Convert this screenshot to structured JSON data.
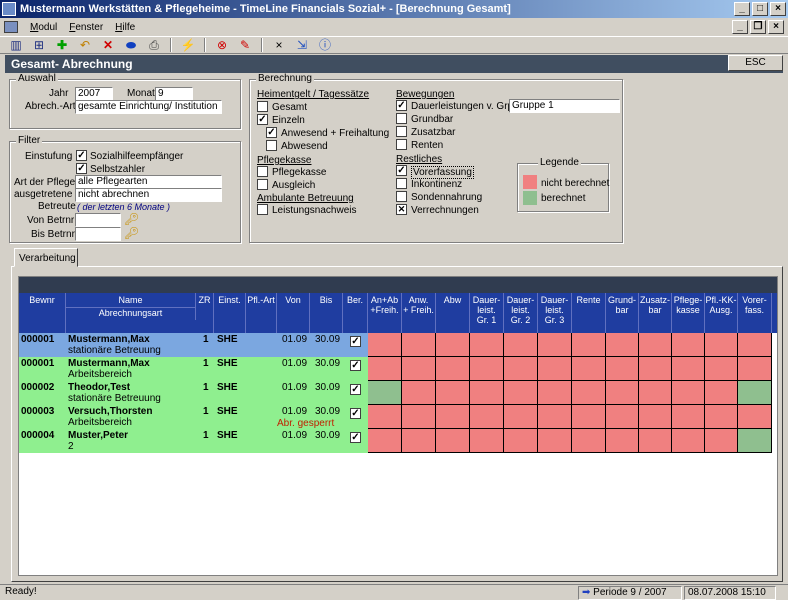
{
  "window": {
    "title": "Mustermann Werkstätten & Pflegeheime - TimeLine Financials Sozial+ - [Berechnung Gesamt]"
  },
  "menu": {
    "items": [
      {
        "label": "Modul",
        "ul": "M",
        "rest": "odul"
      },
      {
        "label": "Fenster",
        "ul": "F",
        "rest": "enster"
      },
      {
        "label": "Hilfe",
        "ul": "H",
        "rest": "ilfe"
      }
    ]
  },
  "toolbar": {
    "icons": [
      "view-icon",
      "tree-icon",
      "add-icon",
      "undo-icon",
      "delete-icon",
      "save-icon",
      "print-icon",
      "lightning-icon",
      "stop-icon",
      "edit-icon",
      "close-icon",
      "export-icon",
      "help-icon"
    ]
  },
  "header": {
    "title": "Gesamt- Abrechnung",
    "esc_label": "ESC"
  },
  "auswahl": {
    "title": "Auswahl",
    "jahr_label": "Jahr",
    "jahr": "2007",
    "monat_label": "Monat",
    "monat": "9",
    "abrech_label": "Abrech.-Art",
    "abrech": "gesamte Einrichtung/ Institution"
  },
  "filter": {
    "title": "Filter",
    "einstufung_label": "Einstufung",
    "sozialhilfe": "Sozialhilfeempfänger",
    "selbstzahler": "Selbstzahler",
    "pflege_label": "Art der Pflege",
    "pflege": "alle Pflegearten",
    "ausgetretene_label": "ausgetretene",
    "ausgetretene": "nicht abrechnen",
    "betreute_label": "Betreute",
    "betreute": "( der letzten 6 Monate )",
    "von_label": "Von Betrnr",
    "bis_label": "Bis Betrnr"
  },
  "berechnung": {
    "title": "Berechnung",
    "heim_title": "Heimentgelt / Tagessätze",
    "gesamt": "Gesamt",
    "einzeln": "Einzeln",
    "anwesend_frei": "Anwesend + Freihaltung",
    "abwesend": "Abwesend",
    "pflege_title": "Pflegekasse",
    "pflegekasse": "Pflegekasse",
    "ausgleich": "Ausgleich",
    "amb_title": "Ambulante Betreuung",
    "leistung": "Leistungsnachweis",
    "bew_title": "Bewegungen",
    "dauer": "Dauerleistungen v. Grp.",
    "gruppe": "Gruppe 1",
    "grundbar": "Grundbar",
    "zusatzbar": "Zusatzbar",
    "renten": "Renten",
    "rest_title": "Restliches",
    "vorerfassung": "Vorerfassung",
    "inkontinenz": "Inkontinenz",
    "sondennahrung": "Sondennahrung",
    "verrechnungen": "Verrechnungen"
  },
  "legende": {
    "title": "Legende",
    "items": [
      {
        "label": "nicht berechnet",
        "color": "#f08080"
      },
      {
        "label": "berechnet",
        "color": "#8fbf8f"
      }
    ]
  },
  "tab": {
    "label": "Verarbeitung"
  },
  "grid": {
    "headers": {
      "bewnr": "Bewnr",
      "name": "Name",
      "abrechnungsart": "Abrechnungsart",
      "zr": "ZR",
      "einst": "Einst.",
      "pfl_art": "Pfl.-Art",
      "von": "Von",
      "bis": "Bis",
      "ber": "Ber.",
      "cols": [
        [
          "An+Ab",
          "+Freih."
        ],
        [
          "Anw.",
          "+ Freih."
        ],
        [
          "Abw",
          ""
        ],
        [
          "Dauer-",
          "leist.",
          "Gr. 1"
        ],
        [
          "Dauer-",
          "leist.",
          "Gr. 2"
        ],
        [
          "Dauer-",
          "leist.",
          "Gr. 3"
        ],
        [
          "Rente",
          ""
        ],
        [
          "Grund-",
          "bar"
        ],
        [
          "Zusatz-",
          "bar"
        ],
        [
          "Pflege-",
          "kasse"
        ],
        [
          "Pfl.-KK-",
          "Ausg."
        ],
        [
          "Vorer-",
          "fass."
        ]
      ]
    },
    "rows": [
      {
        "bewnr": "000001",
        "name": "Mustermann,Max",
        "art": "stationäre Betreuung",
        "zr": "1",
        "einst": "SHE",
        "von": "01.09",
        "bis": "30.09",
        "ber": true,
        "note": "",
        "bg": "#7ba7e0",
        "cells": [
          "r",
          "r",
          "r",
          "r",
          "r",
          "r",
          "r",
          "r",
          "r",
          "r",
          "r",
          "r"
        ]
      },
      {
        "bewnr": "000001",
        "name": "Mustermann,Max",
        "art": "Arbeitsbereich",
        "zr": "1",
        "einst": "SHE",
        "von": "01.09",
        "bis": "30.09",
        "ber": true,
        "note": "",
        "bg": "#8fef8f",
        "cells": [
          "r",
          "r",
          "r",
          "r",
          "r",
          "r",
          "r",
          "r",
          "r",
          "r",
          "r",
          "r"
        ]
      },
      {
        "bewnr": "000002",
        "name": "Theodor,Test",
        "art": "stationäre Betreuung",
        "zr": "1",
        "einst": "SHE",
        "von": "01.09",
        "bis": "30.09",
        "ber": true,
        "note": "",
        "bg": "#8fef8f",
        "cells": [
          "g",
          "r",
          "r",
          "r",
          "r",
          "r",
          "r",
          "r",
          "r",
          "r",
          "r",
          "g"
        ]
      },
      {
        "bewnr": "000003",
        "name": "Versuch,Thorsten",
        "art": "Arbeitsbereich",
        "zr": "1",
        "einst": "SHE",
        "von": "01.09",
        "bis": "30.09",
        "ber": true,
        "note": "Abr. gesperrt",
        "bg": "#8fef8f",
        "cells": [
          "r",
          "r",
          "r",
          "r",
          "r",
          "r",
          "r",
          "r",
          "r",
          "r",
          "r",
          "r"
        ]
      },
      {
        "bewnr": "000004",
        "name": "Muster,Peter",
        "art": "2",
        "zr": "1",
        "einst": "SHE",
        "von": "01.09",
        "bis": "30.09",
        "ber": true,
        "note": "",
        "bg": "#8fef8f",
        "cells": [
          "r",
          "r",
          "r",
          "r",
          "r",
          "r",
          "r",
          "r",
          "r",
          "r",
          "r",
          "g"
        ]
      }
    ]
  },
  "status": {
    "ready": "Ready!",
    "periode": "Periode 9  / 2007",
    "datetime": "08.07.2008 15:10"
  },
  "colors": {
    "red": "#f08080",
    "green": "#8fbf8f"
  }
}
